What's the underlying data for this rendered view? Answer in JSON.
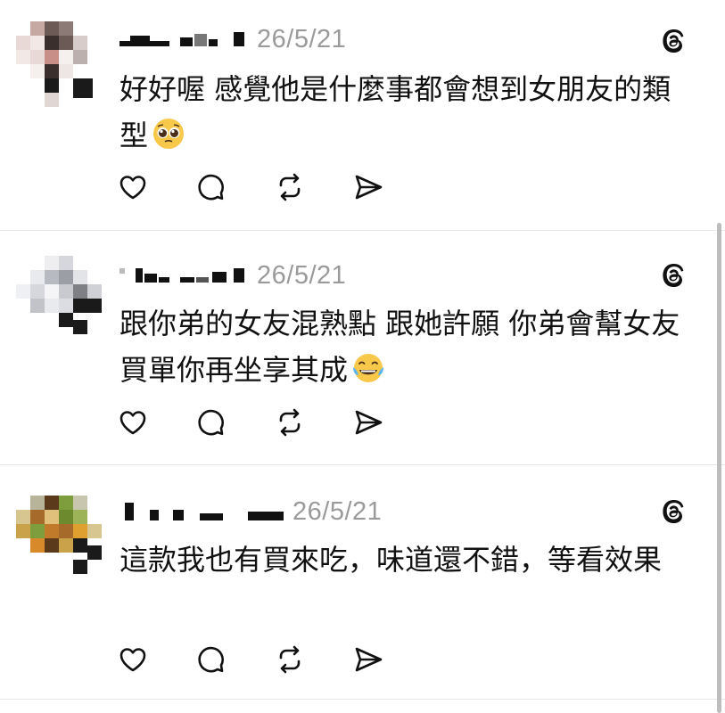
{
  "posts": [
    {
      "date": "26/5/21",
      "text": "好好喔 感覺他是什麼事都會想到女朋友的類型",
      "emoji": "pleading-face",
      "avatar_colors": [
        "#e8d9d6",
        "#6b5a55",
        "#3a2f2c",
        "#c7a9a3",
        "#f2e8e6",
        "#1a1a1a"
      ]
    },
    {
      "date": "26/5/21",
      "text": "跟你弟的女友混熟點 跟她許願 你弟會幫女友買單你再坐享其成",
      "emoji": "face-with-tears-of-joy",
      "avatar_colors": [
        "#e9eaee",
        "#b8bac2",
        "#d6d7dd",
        "#7f7f86",
        "#f5f5f7",
        "#1a1a1a"
      ]
    },
    {
      "date": "26/5/21",
      "text": "這款我也有買來吃，味道還不錯，等看效果",
      "emoji": "",
      "avatar_colors": [
        "#c9a24a",
        "#7e9d3c",
        "#a66a2a",
        "#5a3a1a",
        "#e0c07a",
        "#1a1a1a"
      ]
    }
  ],
  "icons": {
    "threads": "threads-logo-icon",
    "like": "heart-icon",
    "reply": "comment-icon",
    "repost": "repost-icon",
    "share": "send-icon"
  }
}
